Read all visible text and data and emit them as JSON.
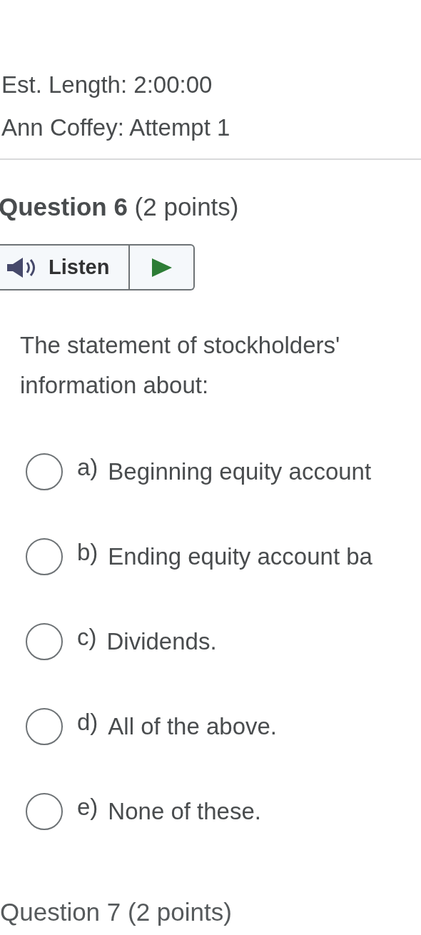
{
  "header": {
    "est_length": "Est. Length: 2:00:00",
    "attempt": "Ann Coffey: Attempt 1"
  },
  "question": {
    "title": "**Question 6** (2 points)",
    "listen": {
      "label": "Listen"
    },
    "text_lines": [
      "The statement of stockholders'",
      "information about:"
    ],
    "options": [
      {
        "letter": "a)",
        "text": "Beginning equity account",
        "selected": false
      },
      {
        "letter": "b)",
        "text": "Ending equity account ba",
        "selected": false
      },
      {
        "letter": "c)",
        "text": "Dividends.",
        "selected": false
      },
      {
        "letter": "d)",
        "text": "All of the above.",
        "selected": false
      },
      {
        "letter": "e)",
        "text": "None of these.",
        "selected": false
      }
    ]
  },
  "next_question": {
    "title": "Question 7 (2 points)"
  }
}
